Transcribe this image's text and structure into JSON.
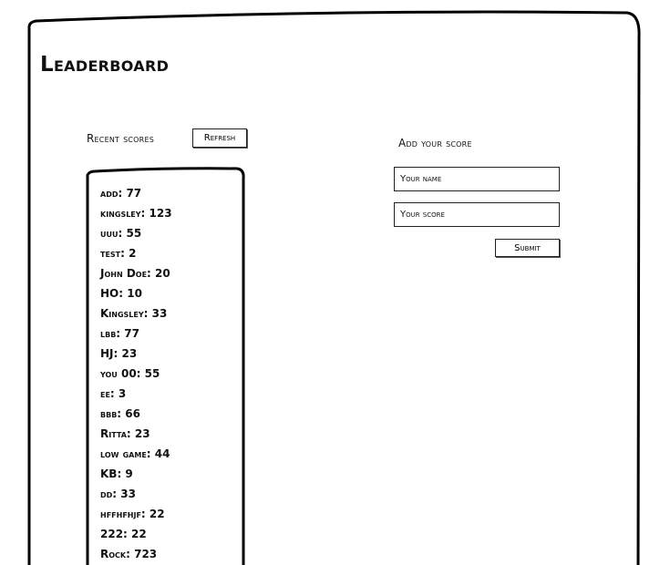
{
  "page": {
    "title": "Leaderboard"
  },
  "scores": {
    "label": "Recent scores",
    "refresh_label": "Refresh",
    "entries": [
      "add: 77",
      "kingsley: 123",
      "uuu: 55",
      "test: 2",
      "John Doe: 20",
      "HO: 10",
      "Kingsley: 33",
      "lbb: 77",
      "HJ: 23",
      "you 00: 55",
      "ee: 3",
      "bbb: 66",
      "Ritta: 23",
      "low game: 44",
      "KB: 9",
      "dd: 33",
      "hffhfhjf: 22",
      "222: 22",
      "Rock: 723"
    ]
  },
  "add_score": {
    "label": "Add your score",
    "name_placeholder": "Your name",
    "score_placeholder": "Your score",
    "submit_label": "Submit"
  }
}
